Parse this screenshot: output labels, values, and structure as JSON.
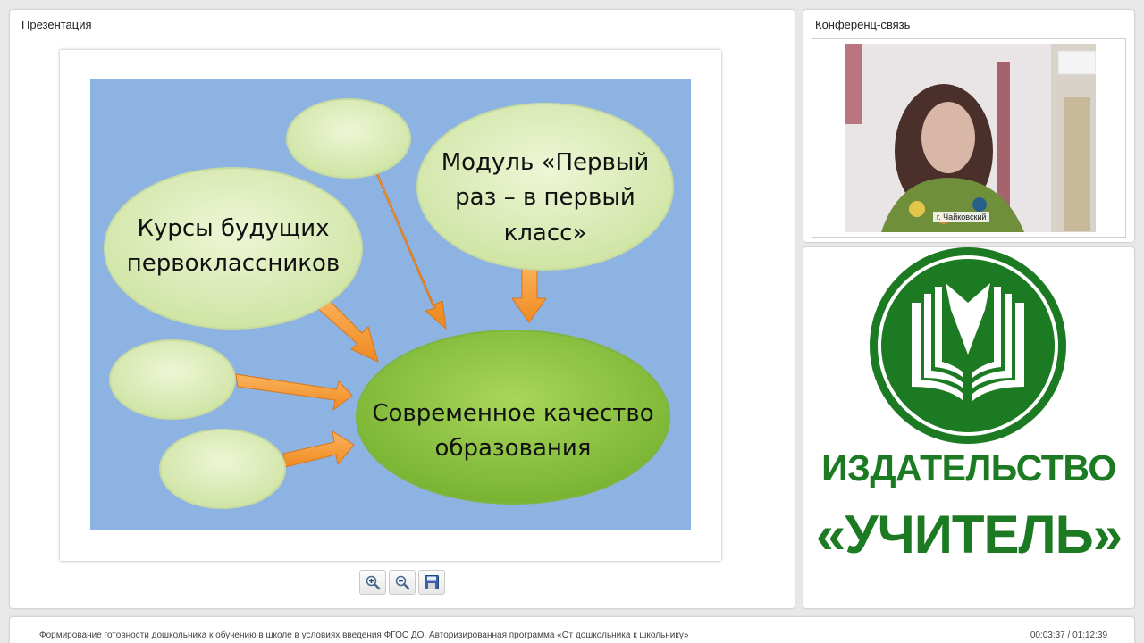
{
  "presentation": {
    "title": "Презентация",
    "slide": {
      "bubble_left": "Курсы будущих|первоклассников",
      "bubble_module": "Модуль «Первый|раз – в первый|класс»",
      "bubble_center": "Современное качество|образования"
    },
    "toolbar": {
      "zoom_in": "zoom-in-icon",
      "zoom_out": "zoom-out-icon",
      "save": "save-icon"
    }
  },
  "conference": {
    "title": "Конференц-связь",
    "video_caption": "г. Чайковский"
  },
  "logo": {
    "line1": "ИЗДАТЕЛЬСТВО",
    "line2": "«УЧИТЕЛЬ»",
    "brand_color": "#1c7a22"
  },
  "footer": {
    "title": "Формирование готовности дошкольника к обучению в школе в условиях введения ФГОС ДО. Авторизированная программа «От дошкольника к школьнику»",
    "time": "00:03:37 / 01:12:39"
  }
}
